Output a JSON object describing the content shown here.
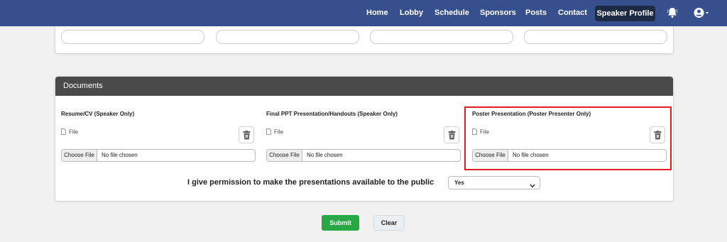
{
  "nav": {
    "items": [
      "Home",
      "Lobby",
      "Schedule",
      "Sponsors",
      "Posts",
      "Contact"
    ],
    "active": "Speaker Profile"
  },
  "documents": {
    "header": "Documents",
    "fields": [
      {
        "title": "Resume/CV (Speaker Only)",
        "file_label": "File",
        "choose_label": "Choose File",
        "status": "No file chosen"
      },
      {
        "title": "Final PPT Presentation/Handouts (Speaker Only)",
        "file_label": "File",
        "choose_label": "Choose File",
        "status": "No file chosen"
      },
      {
        "title": "Poster Presentation (Poster Presenter Only)",
        "file_label": "File",
        "choose_label": "Choose File",
        "status": "No file chosen"
      }
    ],
    "permission_label": "I give permission to make the presentations available to the public",
    "permission_value": "Yes"
  },
  "actions": {
    "submit": "Submit",
    "clear": "Clear"
  },
  "colors": {
    "navbar": "#36508e",
    "active_nav": "#1c2a44",
    "submit": "#28a745",
    "highlight": "#e02020"
  }
}
